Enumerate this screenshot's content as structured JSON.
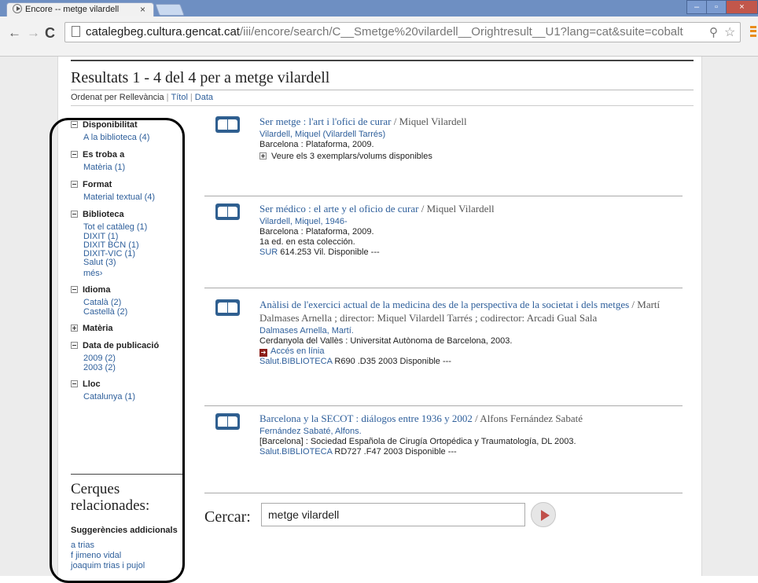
{
  "browser": {
    "tab_title": "Encore -- metge vilardell",
    "tab_close": "×",
    "url_host": "catalegbeg.cultura.gencat.cat",
    "url_path": "/iii/encore/search/C__Smetge%20vilardell__Orightresult__U1?lang=cat&suite=cobalt",
    "icons": {
      "back": "arrow-left-icon",
      "forward": "arrow-right-icon",
      "reload": "reload-icon",
      "zoom": "zoom-icon",
      "bookmark": "star-icon",
      "menu": "menu-icon"
    },
    "window_controls": {
      "minimize": "–",
      "maximize": "▫",
      "close": "×"
    }
  },
  "results": {
    "heading": "Resultats 1 - 4 del 4 per a metge vilardell",
    "sort_prefix": "Ordenat per",
    "sort_current": "Rellevància",
    "sort_options": [
      "Títol",
      "Data"
    ]
  },
  "facets": [
    {
      "name": "Disponibilitat",
      "open": true,
      "items": [
        "A la biblioteca (4)"
      ]
    },
    {
      "name": "Es troba a",
      "open": true,
      "items": [
        "Matèria (1)"
      ]
    },
    {
      "name": "Format",
      "open": true,
      "items": [
        "Material textual (4)"
      ]
    },
    {
      "name": "Biblioteca",
      "open": true,
      "items": [
        "Tot el catàleg (1)",
        "DIXIT (1)",
        "DIXIT BCN (1)",
        "DIXIT-VIC (1)",
        "Salut (3)"
      ],
      "more": "més›"
    },
    {
      "name": "Idioma",
      "open": true,
      "items": [
        "Català (2)",
        "Castellà (2)"
      ]
    },
    {
      "name": "Matèria",
      "open": false,
      "items": []
    },
    {
      "name": "Data de publicació",
      "open": true,
      "items": [
        "2009 (2)",
        "2003 (2)"
      ]
    },
    {
      "name": "Lloc",
      "open": true,
      "items": [
        "Catalunya (1)"
      ]
    }
  ],
  "related": {
    "title_line1": "Cerques",
    "title_line2": "relacionades:",
    "suggestions_heading": "Suggerències addicionals",
    "suggestions": [
      "a trias",
      "f jimeno vidal",
      "joaquim trias i pujol"
    ]
  },
  "records": [
    {
      "title": "Ser metge : l'art i l'ofici de curar",
      "responsibility": " / Miquel Vilardell",
      "author": "Vilardell, Miquel (Vilardell Tarrés)",
      "publication": "Barcelona : Plataforma, 2009.",
      "more_copies": "Veure els 3 exemplars/volums disponibles"
    },
    {
      "title": "Ser médico : el arte y el oficio de curar",
      "responsibility": " / Miquel Vilardell",
      "author": "Vilardell, Miquel, 1946-",
      "publication": "Barcelona : Plataforma, 2009.",
      "edition": "1a ed. en esta colección.",
      "location": "SUR",
      "status": " 614.253 Vil. Disponible ---"
    },
    {
      "title": "Anàlisi de l'exercici actual de la medicina des de la perspectiva de la societat i dels metges",
      "responsibility": " / Martí Dalmases Arnella ; director: Miquel Vilardell Tarrés ; codirector: Arcadi Gual Sala",
      "author": "Dalmases Arnella, Martí.",
      "publication": "Cerdanyola del Vallès : Universitat Autònoma de Barcelona, 2003.",
      "online": "Accés en línia",
      "location": "Salut.BIBLIOTECA",
      "status": " R690 .D35 2003 Disponible ---"
    },
    {
      "title": "Barcelona y la SECOT : diálogos entre 1936 y 2002",
      "responsibility": " / Alfons Fernández Sabaté",
      "author": "Fernández Sabaté, Alfons.",
      "publication": "[Barcelona] : Sociedad Española de Cirugía Ortopédica y Traumatología, DL 2003.",
      "location": "Salut.BIBLIOTECA",
      "status": " RD727 .F47 2003 Disponible ---"
    }
  ],
  "search": {
    "label": "Cercar:",
    "value": "metge vilardell",
    "submit_icon": "play-icon"
  },
  "colors": {
    "link": "#2e5f9b",
    "book_icon": "#2f5f90",
    "search_button_arrow": "#c0504a",
    "titlebar": "#6e8fc2"
  }
}
